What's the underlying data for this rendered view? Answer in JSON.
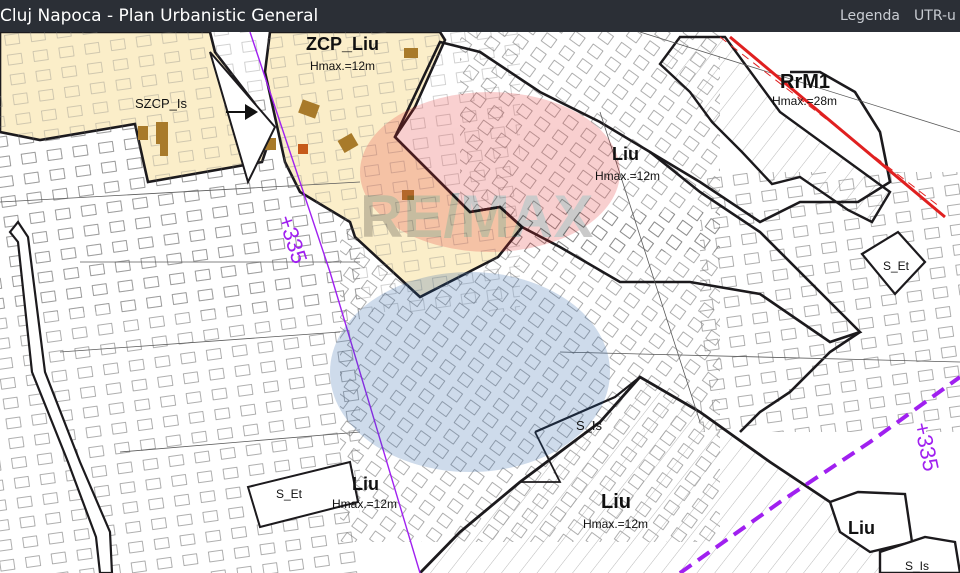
{
  "header": {
    "title": "Cluj Napoca - Plan Urbanistic General",
    "nav": [
      {
        "label": "Legenda"
      },
      {
        "label": "UTR-u"
      }
    ]
  },
  "map": {
    "zones": [
      {
        "code": "ZCP_Liu",
        "hmax": "Hmax.=12m"
      },
      {
        "code": "SZCP_Is"
      },
      {
        "code": "RrM1",
        "hmax": "Hmax.=28m"
      },
      {
        "code": "Liu",
        "hmax": "Hmax.=12m"
      },
      {
        "code": "S_Et"
      },
      {
        "code": "S_Is"
      },
      {
        "code": "Liu",
        "hmax": "Hmax.=12m"
      },
      {
        "code": "S_Et"
      },
      {
        "code": "Liu",
        "hmax": "Hmax.=12m"
      },
      {
        "code": "Liu"
      },
      {
        "code": "S_Is"
      }
    ],
    "elevations": [
      "+335",
      "+335"
    ],
    "watermark": "RE/MAX",
    "colors": {
      "protected_zone_fill": "#fbeec9",
      "zone_boundary": "#1c1a1d",
      "contour_line": "#a020f0",
      "red_line": "#e02020",
      "building": "#a87a2a"
    }
  }
}
